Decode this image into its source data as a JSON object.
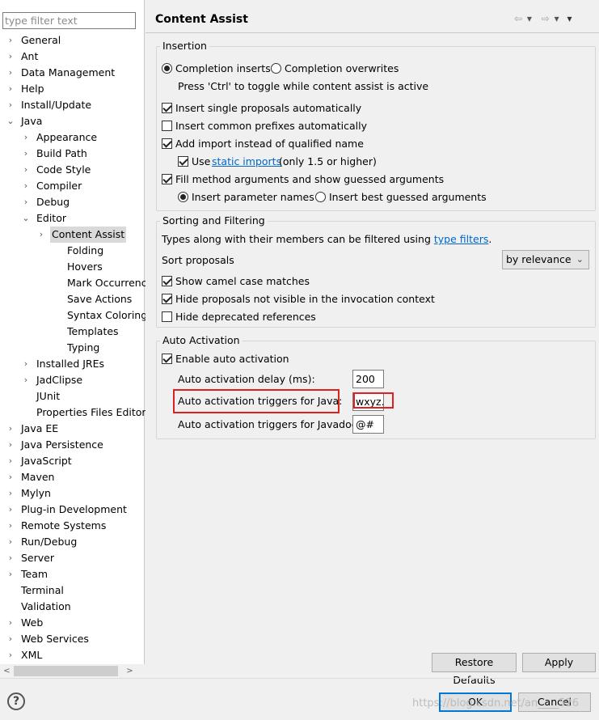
{
  "filter": {
    "placeholder": "type filter text"
  },
  "tree": [
    {
      "label": "General",
      "chev": "›"
    },
    {
      "label": "Ant",
      "chev": "›"
    },
    {
      "label": "Data Management",
      "chev": "›"
    },
    {
      "label": "Help",
      "chev": "›"
    },
    {
      "label": "Install/Update",
      "chev": "›"
    },
    {
      "label": "Java",
      "chev": "⌄"
    },
    {
      "label": "Appearance",
      "chev": "›"
    },
    {
      "label": "Build Path",
      "chev": "›"
    },
    {
      "label": "Code Style",
      "chev": "›"
    },
    {
      "label": "Compiler",
      "chev": "›"
    },
    {
      "label": "Debug",
      "chev": "›"
    },
    {
      "label": "Editor",
      "chev": "⌄"
    },
    {
      "label": "Content Assist",
      "chev": "›"
    },
    {
      "label": "Folding",
      "chev": ""
    },
    {
      "label": "Hovers",
      "chev": ""
    },
    {
      "label": "Mark Occurrences",
      "chev": ""
    },
    {
      "label": "Save Actions",
      "chev": ""
    },
    {
      "label": "Syntax Coloring",
      "chev": ""
    },
    {
      "label": "Templates",
      "chev": ""
    },
    {
      "label": "Typing",
      "chev": ""
    },
    {
      "label": "Installed JREs",
      "chev": "›"
    },
    {
      "label": "JadClipse",
      "chev": "›"
    },
    {
      "label": "JUnit",
      "chev": ""
    },
    {
      "label": "Properties Files Editor",
      "chev": ""
    },
    {
      "label": "Java EE",
      "chev": "›"
    },
    {
      "label": "Java Persistence",
      "chev": "›"
    },
    {
      "label": "JavaScript",
      "chev": "›"
    },
    {
      "label": "Maven",
      "chev": "›"
    },
    {
      "label": "Mylyn",
      "chev": "›"
    },
    {
      "label": "Plug-in Development",
      "chev": "›"
    },
    {
      "label": "Remote Systems",
      "chev": "›"
    },
    {
      "label": "Run/Debug",
      "chev": "›"
    },
    {
      "label": "Server",
      "chev": "›"
    },
    {
      "label": "Team",
      "chev": "›"
    },
    {
      "label": "Terminal",
      "chev": ""
    },
    {
      "label": "Validation",
      "chev": ""
    },
    {
      "label": "Web",
      "chev": "›"
    },
    {
      "label": "Web Services",
      "chev": "›"
    },
    {
      "label": "XML",
      "chev": "›"
    }
  ],
  "scroll": {
    "left": "<",
    "right": ">"
  },
  "page": {
    "title": "Content Assist"
  },
  "nav": {
    "back": "⇦",
    "back_menu": "▾",
    "forward": "⇨",
    "forward_menu": "▾",
    "view_menu": "▾"
  },
  "insertion": {
    "title": "Insertion",
    "completion_inserts": "Completion inserts",
    "completion_overwrites": "Completion overwrites",
    "toggle_hint": "Press 'Ctrl' to toggle while content assist is active",
    "insert_single": "Insert single proposals automatically",
    "insert_common": "Insert common prefixes automatically",
    "add_import": "Add import instead of qualified name",
    "use": "Use",
    "static_imports": "static imports",
    "static_suffix": "(only 1.5 or higher)",
    "fill_method": "Fill method arguments and show guessed arguments",
    "insert_param": "Insert parameter names",
    "insert_best": "Insert best guessed arguments"
  },
  "sorting": {
    "title": "Sorting and Filtering",
    "types_prefix": "Types along with their members can be filtered using",
    "type_filters": "type filters",
    "types_suffix": ".",
    "sort_label": "Sort proposals",
    "sort_value": "by relevance",
    "camel": "Show camel case matches",
    "hide_not_visible": "Hide proposals not visible in the invocation context",
    "hide_deprecated": "Hide deprecated references"
  },
  "auto": {
    "title": "Auto Activation",
    "enable": "Enable auto activation",
    "delay_label": "Auto activation delay (ms):",
    "delay_value": "200",
    "java_label": "Auto activation triggers for Java:",
    "java_value": "wxyz.",
    "javadoc_label": "Auto activation triggers for Javadoc:",
    "javadoc_value": "@#"
  },
  "buttons": {
    "restore": "Restore Defaults",
    "apply": "Apply",
    "ok": "OK",
    "cancel": "Cancel"
  },
  "watermark": "https://blog.csdn.net/an____526"
}
